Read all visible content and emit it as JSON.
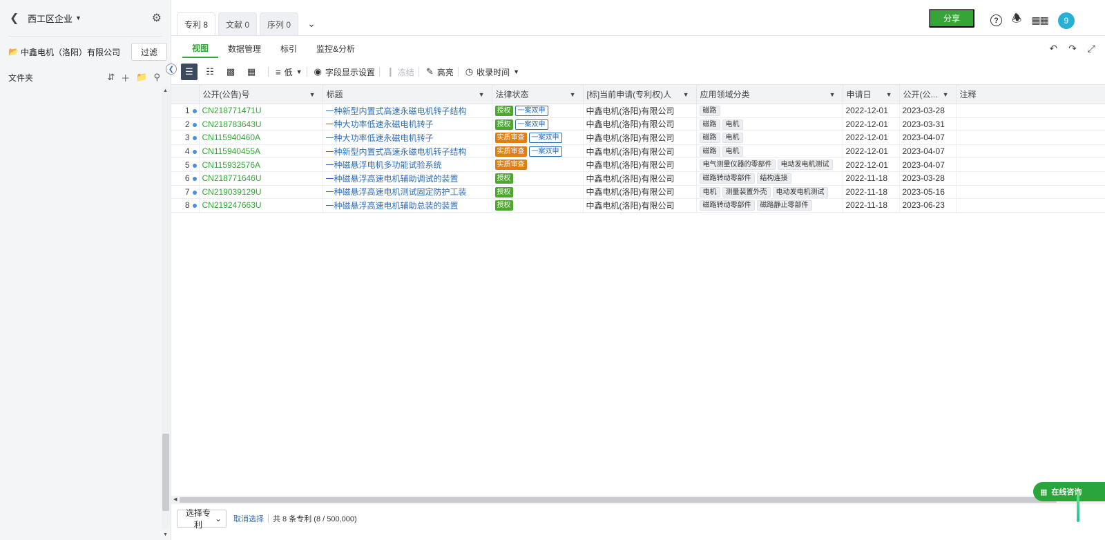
{
  "sidebar": {
    "title": "西工区企业",
    "company": "中鑫电机（洛阳）有限公司",
    "filter_label": "过滤",
    "folder_label": "文件夹"
  },
  "tabs": [
    {
      "label": "专利 8"
    },
    {
      "label": "文献 0"
    },
    {
      "label": "序列 0"
    }
  ],
  "header": {
    "share_label": "分享",
    "avatar_text": "9"
  },
  "subnav": [
    "视图",
    "数据管理",
    "标引",
    "监控&分析"
  ],
  "toolbar": {
    "density_label": "低",
    "fields_label": "字段显示设置",
    "freeze_label": "冻结",
    "highlight_label": "高亮",
    "sort_label": "收录时间"
  },
  "table": {
    "columns": [
      "公开(公告)号",
      "标题",
      "法律状态",
      "[标]当前申请(专利权)人",
      "应用领域分类",
      "申请日",
      "公开(公...",
      "注释"
    ],
    "rows": [
      {
        "n": "1",
        "pn": "CN218771471U",
        "title": "一种新型内置式高速永磁电机转子结构",
        "status": [
          {
            "text": "授权",
            "type": "green"
          },
          {
            "text": "一案双申",
            "type": "outline"
          }
        ],
        "applicant": "中鑫电机(洛阳)有限公司",
        "tags": [
          "磁路"
        ],
        "app_date": "2022-12-01",
        "pub_date": "2023-03-28"
      },
      {
        "n": "2",
        "pn": "CN218783643U",
        "title": "一种大功率低速永磁电机转子",
        "status": [
          {
            "text": "授权",
            "type": "green"
          },
          {
            "text": "一案双申",
            "type": "outline"
          }
        ],
        "applicant": "中鑫电机(洛阳)有限公司",
        "tags": [
          "磁路",
          "电机"
        ],
        "app_date": "2022-12-01",
        "pub_date": "2023-03-31"
      },
      {
        "n": "3",
        "pn": "CN115940460A",
        "title": "一种大功率低速永磁电机转子",
        "status": [
          {
            "text": "实质审查",
            "type": "orange"
          },
          {
            "text": "一案双申",
            "type": "outline"
          }
        ],
        "applicant": "中鑫电机(洛阳)有限公司",
        "tags": [
          "磁路",
          "电机"
        ],
        "app_date": "2022-12-01",
        "pub_date": "2023-04-07"
      },
      {
        "n": "4",
        "pn": "CN115940455A",
        "title": "一种新型内置式高速永磁电机转子结构",
        "status": [
          {
            "text": "实质审查",
            "type": "orange"
          },
          {
            "text": "一案双申",
            "type": "outline"
          }
        ],
        "applicant": "中鑫电机(洛阳)有限公司",
        "tags": [
          "磁路",
          "电机"
        ],
        "app_date": "2022-12-01",
        "pub_date": "2023-04-07"
      },
      {
        "n": "5",
        "pn": "CN115932576A",
        "title": "一种磁悬浮电机多功能试验系统",
        "status": [
          {
            "text": "实质审查",
            "type": "orange"
          }
        ],
        "applicant": "中鑫电机(洛阳)有限公司",
        "tags": [
          "电气测量仪器的零部件",
          "电动发电机测试"
        ],
        "app_date": "2022-12-01",
        "pub_date": "2023-04-07"
      },
      {
        "n": "6",
        "pn": "CN218771646U",
        "title": "一种磁悬浮高速电机辅助调试的装置",
        "status": [
          {
            "text": "授权",
            "type": "green"
          }
        ],
        "applicant": "中鑫电机(洛阳)有限公司",
        "tags": [
          "磁路转动零部件",
          "结构连接"
        ],
        "app_date": "2022-11-18",
        "pub_date": "2023-03-28"
      },
      {
        "n": "7",
        "pn": "CN219039129U",
        "title": "一种磁悬浮高速电机测试固定防护工装",
        "status": [
          {
            "text": "授权",
            "type": "green"
          }
        ],
        "applicant": "中鑫电机(洛阳)有限公司",
        "tags": [
          "电机",
          "测量装置外壳",
          "电动发电机测试"
        ],
        "app_date": "2022-11-18",
        "pub_date": "2023-05-16"
      },
      {
        "n": "8",
        "pn": "CN219247663U",
        "title": "一种磁悬浮高速电机辅助总装的装置",
        "status": [
          {
            "text": "授权",
            "type": "green"
          }
        ],
        "applicant": "中鑫电机(洛阳)有限公司",
        "tags": [
          "磁路转动零部件",
          "磁路静止零部件"
        ],
        "app_date": "2022-11-18",
        "pub_date": "2023-06-23"
      }
    ]
  },
  "footer": {
    "select_label": "选择专利",
    "cancel_label": "取消选择",
    "count_text": "共 8 条专利 (8 / 500,000)"
  },
  "chat": {
    "label": "在线咨询"
  },
  "colors": {
    "accent": "#35a537",
    "link": "#2f6db5",
    "granted": "#4da72e",
    "examining": "#df7f10"
  }
}
